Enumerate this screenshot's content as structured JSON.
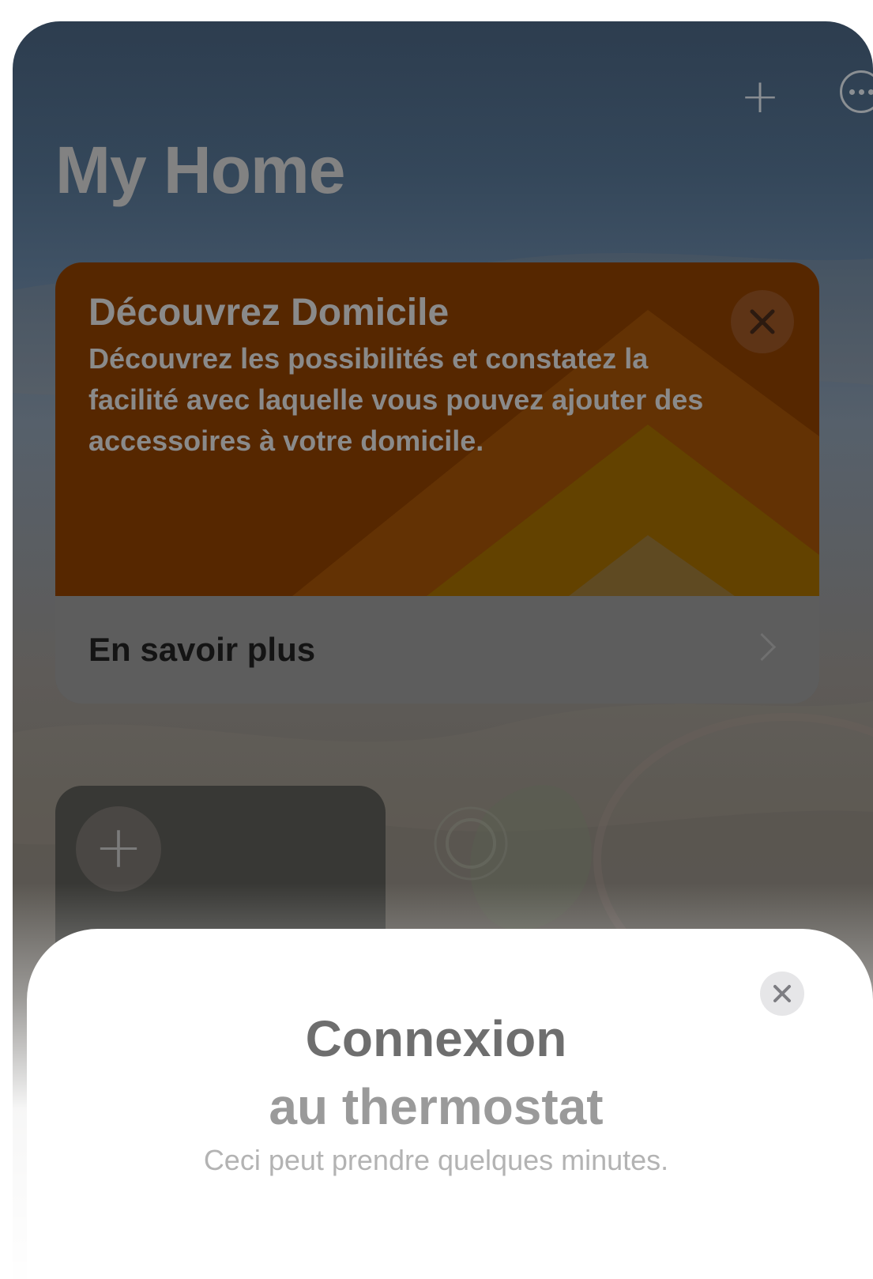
{
  "header": {
    "add_icon": "plus-icon",
    "more_icon": "ellipsis-circle-icon",
    "title": "My Home"
  },
  "promo_card": {
    "title": "Découvrez Domicile",
    "description": "Découvrez les possibilités et constatez la facilité avec laquelle vous pouvez ajouter des accessoires à votre domicile.",
    "close_icon": "close-icon",
    "learn_more_label": "En savoir plus",
    "chevron_icon": "chevron-right-icon",
    "colors": {
      "top": "#562700",
      "shape_1": "#633204",
      "shape_2": "#634200"
    }
  },
  "add_tile": {
    "icon": "plus-icon"
  },
  "sheet": {
    "title_line1": "Connexion",
    "title_line2": "au thermostat",
    "subtitle": "Ceci peut prendre quelques minutes.",
    "close_icon": "close-icon"
  }
}
